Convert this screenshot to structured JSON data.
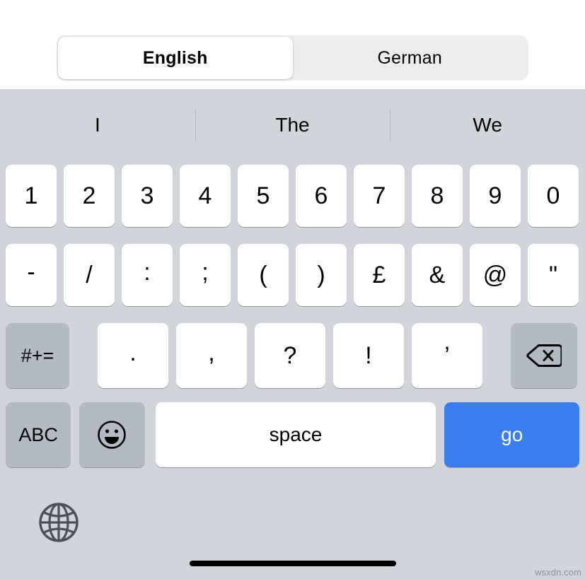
{
  "language_switcher": {
    "options": [
      {
        "label": "English",
        "selected": true
      },
      {
        "label": "German",
        "selected": false
      }
    ]
  },
  "suggestions": [
    "I",
    "The",
    "We"
  ],
  "keyboard": {
    "layout_name": "numeric-symbols",
    "rows": {
      "row1": [
        "1",
        "2",
        "3",
        "4",
        "5",
        "6",
        "7",
        "8",
        "9",
        "0"
      ],
      "row2": [
        "-",
        "/",
        ":",
        ";",
        "(",
        ")",
        "£",
        "&",
        "@",
        "\""
      ],
      "row3_symbol_switch": "#+=",
      "row3_punctuation": [
        ".",
        ",",
        "?",
        "!",
        "’"
      ],
      "row3_backspace_icon": "delete-left-icon",
      "row4": {
        "alphabet_label": "ABC",
        "emoji_icon": "smiley-face-icon",
        "space_label": "space",
        "return_label": "go"
      }
    }
  },
  "globe_icon": "globe-icon",
  "home_indicator": "home-indicator-bar",
  "watermark": "wsxdn.com",
  "colors": {
    "keyboard_background": "#d1d5db",
    "key_white": "#ffffff",
    "key_gray": "#b4bac4",
    "accent_blue": "#3b7dee",
    "text_primary": "#000000",
    "segment_track": "#ececec"
  }
}
